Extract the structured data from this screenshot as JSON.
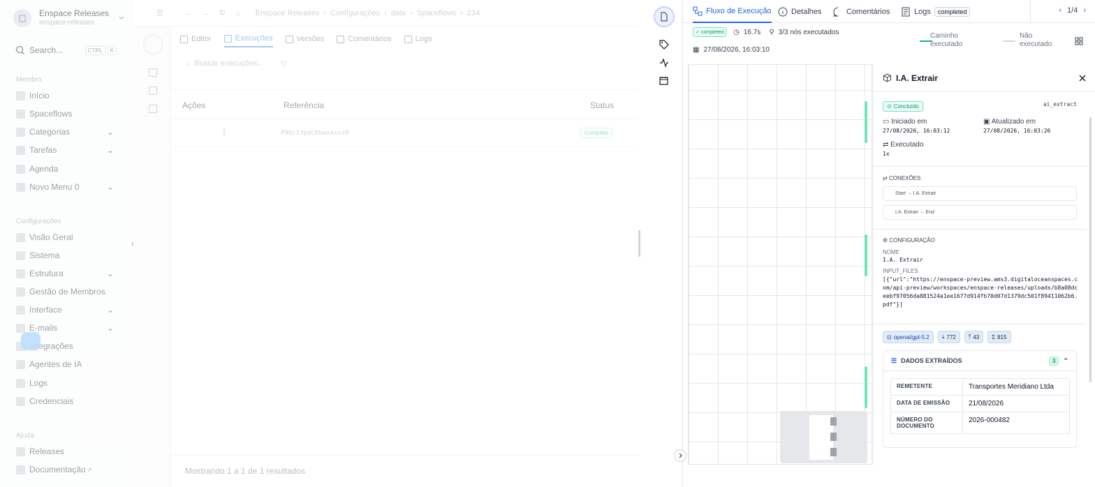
{
  "sidebar": {
    "workspace_name": "Enspace Releases",
    "workspace_slug": "enspace-releases",
    "search_placeholder": "Search...",
    "search_kbd": [
      "CTRL",
      "K"
    ],
    "sections": [
      {
        "title": "Membro",
        "items": [
          "Início",
          "Spaceflows",
          "Categorias",
          "Tarefas",
          "Agenda",
          "Novo Menu 0"
        ]
      },
      {
        "title": "Configurações",
        "items": [
          "Visão Geral",
          "Sistema",
          "Estrutura",
          "Gestão de Membros",
          "Interface",
          "E-mails",
          "Integrações",
          "Agentes de IA",
          "Logs",
          "Credenciais"
        ]
      },
      {
        "title": "Ajuda",
        "items": [
          "Releases",
          "Documentação"
        ]
      }
    ]
  },
  "middle": {
    "breadcrumb": [
      "Enspace Releases",
      "Configurações",
      "data",
      "Spaceflows",
      "234"
    ],
    "tabs": [
      "Editor",
      "Execuções",
      "Versões",
      "Comentários",
      "Logs"
    ],
    "active_tab": "Execuções",
    "search_placeholder": "Buscar execuções...",
    "columns": [
      "Ações",
      "Referência",
      "Status"
    ],
    "rows": [
      {
        "reference": "P0QcI3peCRbwx4svzH",
        "status": "Completo"
      }
    ],
    "footer": "Mostrando 1 a 1 de 1 resultados"
  },
  "panel": {
    "tabs": [
      "Fluxo de Execução",
      "Detalhes",
      "Comentários",
      "Logs"
    ],
    "logs_badge": "completed",
    "pager": "1/4",
    "status_badge": "completed",
    "duration": "16.7s",
    "nodes_executed": "3/3 nós executados",
    "date": "27/08/2026, 16:03:10",
    "legend": [
      {
        "label": "Caminho executado",
        "color": "#10b981"
      },
      {
        "label": "Não executado",
        "color": "#d1d5db"
      }
    ]
  },
  "detail": {
    "title": "I.A. Extrair",
    "status": "Concluído",
    "type": "ai_extract",
    "started_label": "Iniciado em",
    "started": "27/08/2026, 16:03:12",
    "updated_label": "Atualizado em",
    "updated": "27/08/2026, 16:03:26",
    "executed_label": "Executado",
    "executed": "1x",
    "connections_title": "CONEXÕES",
    "connections": [
      "Start → I.A. Extrair",
      "I.A. Extrair → End"
    ],
    "config_title": "CONFIGURAÇÃO",
    "name_label": "NOME",
    "name": "I.A. Extrair",
    "input_label": "INPUT_FILES",
    "input_files": "[{\"url\":\"https://enspace-preview.ams3.digitaloceanspaces.com/api-preview/workspaces/enspace-releases/uploads/b8a08dceebf97056da881524a1ee1677d914fb70d07d1379dc501f89411062b6.pdf\"}]",
    "model": "openai/gpt-5.2",
    "tokens_in": "772",
    "tokens_out": "43",
    "tokens_total": "815",
    "extracted_title": "DADOS EXTRAÍDOS",
    "extracted_count": "3",
    "extracted": [
      {
        "key": "REMETENTE",
        "value": "Transportes Meridiano Ltda"
      },
      {
        "key": "DATA DE EMISSÃO",
        "value": "21/08/2026"
      },
      {
        "key": "NÚMERO DO DOCUMENTO",
        "value": "2026-000482"
      }
    ]
  }
}
